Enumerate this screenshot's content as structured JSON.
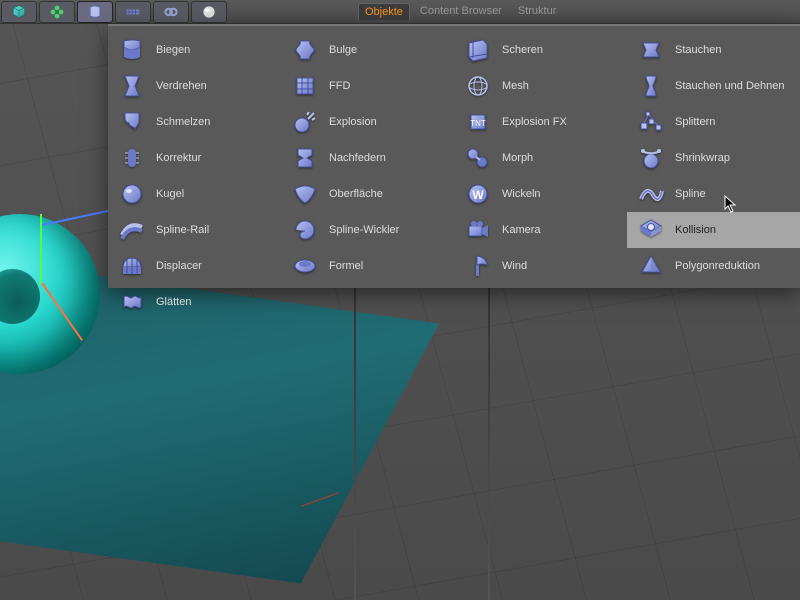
{
  "tabs": {
    "active": "Objekte",
    "t1": "Objekte",
    "t2": "Content Browser",
    "t3": "Struktur"
  },
  "toolbar_icons": [
    "cube-icon",
    "flower-icon",
    "curve-icon",
    "pattern-icon",
    "chain-icon",
    "sphere-icon"
  ],
  "menu": {
    "col1": [
      {
        "name": "biegen",
        "label": "Biegen"
      },
      {
        "name": "verdrehen",
        "label": "Verdrehen"
      },
      {
        "name": "schmelzen",
        "label": "Schmelzen"
      },
      {
        "name": "korrektur",
        "label": "Korrektur"
      },
      {
        "name": "kugel",
        "label": "Kugel"
      },
      {
        "name": "spline-rail",
        "label": "Spline-Rail"
      },
      {
        "name": "displacer",
        "label": "Displacer"
      },
      {
        "name": "glaetten",
        "label": "Glätten"
      }
    ],
    "col2": [
      {
        "name": "bulge",
        "label": "Bulge"
      },
      {
        "name": "ffd",
        "label": "FFD"
      },
      {
        "name": "explosion",
        "label": "Explosion"
      },
      {
        "name": "nachfedern",
        "label": "Nachfedern"
      },
      {
        "name": "oberflaeche",
        "label": "Oberfläche"
      },
      {
        "name": "spline-wickler",
        "label": "Spline-Wickler"
      },
      {
        "name": "formel",
        "label": "Formel"
      }
    ],
    "col3": [
      {
        "name": "scheren",
        "label": "Scheren"
      },
      {
        "name": "mesh",
        "label": "Mesh"
      },
      {
        "name": "explosion-fx",
        "label": "Explosion FX"
      },
      {
        "name": "morph",
        "label": "Morph"
      },
      {
        "name": "wickeln",
        "label": "Wickeln"
      },
      {
        "name": "kamera",
        "label": "Kamera"
      },
      {
        "name": "wind",
        "label": "Wind"
      }
    ],
    "col4": [
      {
        "name": "stauchen",
        "label": "Stauchen"
      },
      {
        "name": "stauchen-und-dehnen",
        "label": "Stauchen und Dehnen"
      },
      {
        "name": "splittern",
        "label": "Splittern"
      },
      {
        "name": "shrinkwrap",
        "label": "Shrinkwrap"
      },
      {
        "name": "spline",
        "label": "Spline"
      },
      {
        "name": "kollision",
        "label": "Kollision",
        "highlight": true
      },
      {
        "name": "polygonreduktion",
        "label": "Polygonreduktion"
      }
    ]
  },
  "colors": {
    "icon_light": "#b8c0ee",
    "icon_dark": "#6b79c9",
    "accent": "#f7941d"
  }
}
